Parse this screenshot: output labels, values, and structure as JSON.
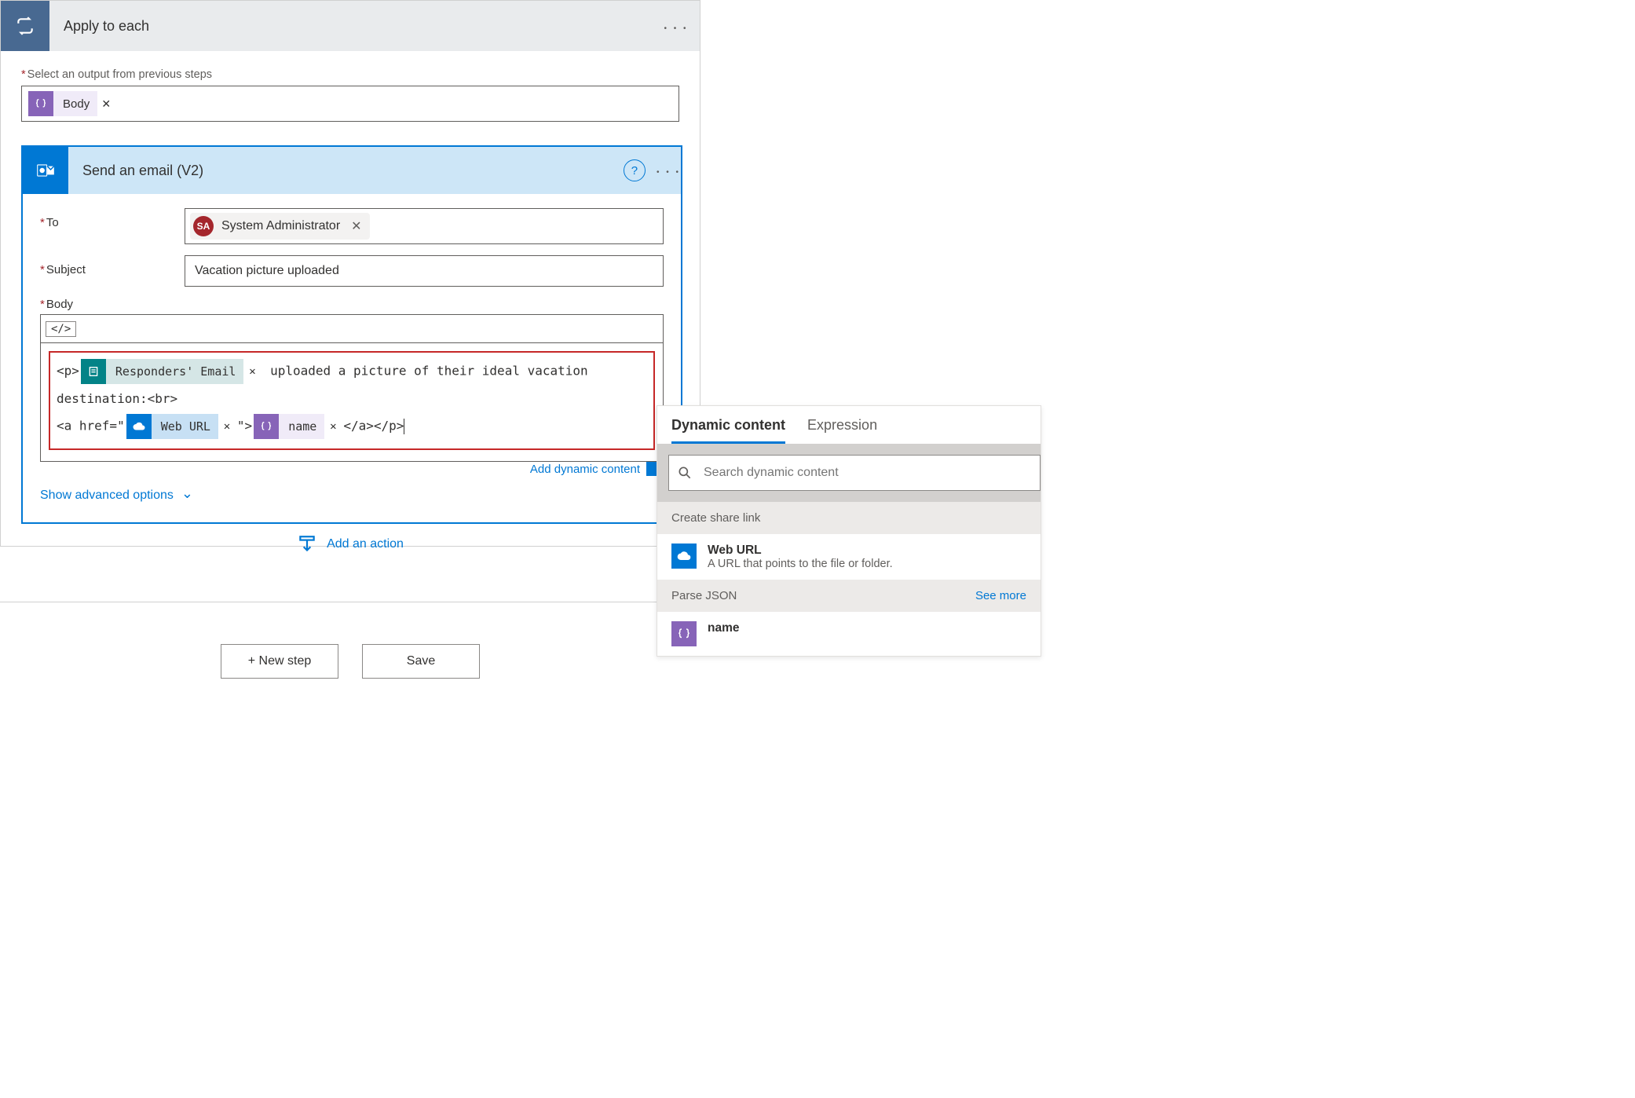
{
  "outer": {
    "title": "Apply to each",
    "output_label": "Select an output from previous steps",
    "body_token": "Body"
  },
  "inner": {
    "title": "Send an email (V2)",
    "to_label": "To",
    "subject_label": "Subject",
    "body_label": "Body",
    "to_chip": {
      "initials": "SA",
      "name": "System Administrator"
    },
    "subject_value": "Vacation picture uploaded",
    "body_parts": {
      "p_open": "<p>",
      "forms_token": "Responders' Email",
      "text1": " uploaded a picture of their ideal vacation destination:<br>",
      "a_open": "<a href=\"",
      "weburl_token": "Web URL",
      "a_mid": "\">",
      "name_token": "name",
      "tail": "</a></p>"
    },
    "add_dynamic": "Add dynamic content",
    "show_advanced": "Show advanced options"
  },
  "add_action": "Add an action",
  "footer": {
    "new_step": "+ New step",
    "save": "Save"
  },
  "dyn": {
    "tab_dynamic": "Dynamic content",
    "tab_expression": "Expression",
    "search_placeholder": "Search dynamic content",
    "sections": {
      "share": {
        "title": "Create share link",
        "item_name": "Web URL",
        "item_desc": "A URL that points to the file or folder."
      },
      "parse": {
        "title": "Parse JSON",
        "see_more": "See more",
        "item_name": "name"
      }
    }
  }
}
